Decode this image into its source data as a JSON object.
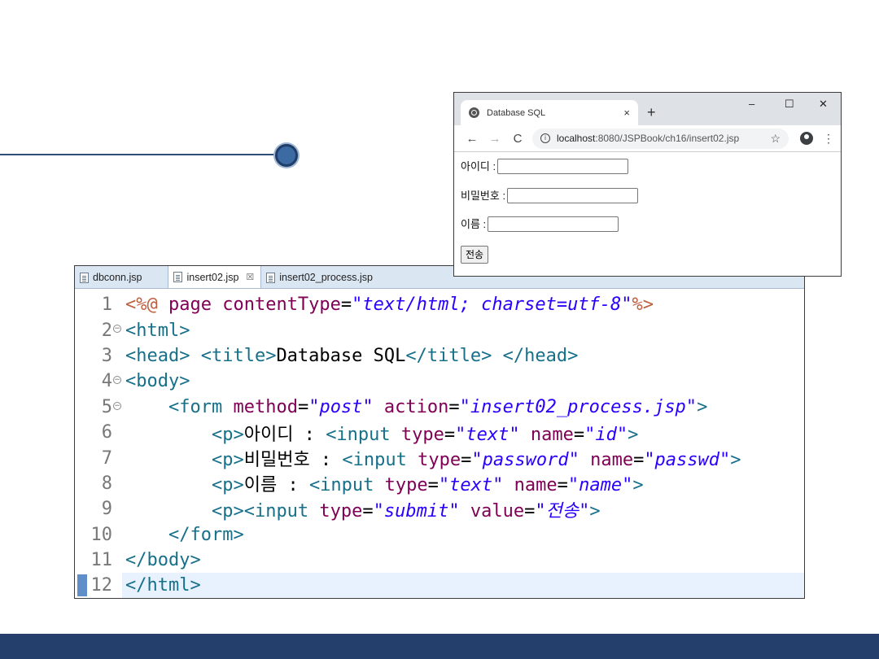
{
  "editor": {
    "tabs": [
      {
        "label": "dbconn.jsp",
        "active": false
      },
      {
        "label": "insert02.jsp",
        "active": true
      },
      {
        "label": "insert02_process.jsp",
        "active": false
      }
    ],
    "close_glyph": "☒",
    "lines": [
      {
        "num": "1",
        "fold": false,
        "tokens": [
          [
            "dir",
            "<%@ "
          ],
          [
            "attr",
            "page "
          ],
          [
            "attr",
            "contentType"
          ],
          [
            "text",
            "="
          ],
          [
            "val",
            "\"text/html; charset=utf-8\""
          ],
          [
            "dir",
            "%>"
          ]
        ]
      },
      {
        "num": "2",
        "fold": true,
        "tokens": [
          [
            "tag",
            "<html>"
          ]
        ]
      },
      {
        "num": "3",
        "fold": false,
        "tokens": [
          [
            "tag",
            "<head> "
          ],
          [
            "tag",
            "<title>"
          ],
          [
            "text",
            "Database SQL"
          ],
          [
            "tag",
            "</title> "
          ],
          [
            "tag",
            "</head>"
          ]
        ]
      },
      {
        "num": "4",
        "fold": true,
        "tokens": [
          [
            "tag",
            "<body>"
          ]
        ]
      },
      {
        "num": "5",
        "fold": true,
        "tokens": [
          [
            "text",
            "    "
          ],
          [
            "tag",
            "<form "
          ],
          [
            "attr",
            "method"
          ],
          [
            "text",
            "="
          ],
          [
            "val",
            "\"post\" "
          ],
          [
            "attr",
            "action"
          ],
          [
            "text",
            "="
          ],
          [
            "val",
            "\"insert02_process.jsp\""
          ],
          [
            "tag",
            ">"
          ]
        ]
      },
      {
        "num": "6",
        "fold": false,
        "tokens": [
          [
            "text",
            "        "
          ],
          [
            "tag",
            "<p>"
          ],
          [
            "text",
            "아이디 : "
          ],
          [
            "tag",
            "<input "
          ],
          [
            "attr",
            "type"
          ],
          [
            "text",
            "="
          ],
          [
            "val",
            "\"text\" "
          ],
          [
            "attr",
            "name"
          ],
          [
            "text",
            "="
          ],
          [
            "val",
            "\"id\""
          ],
          [
            "tag",
            ">"
          ]
        ]
      },
      {
        "num": "7",
        "fold": false,
        "tokens": [
          [
            "text",
            "        "
          ],
          [
            "tag",
            "<p>"
          ],
          [
            "text",
            "비밀번호 : "
          ],
          [
            "tag",
            "<input "
          ],
          [
            "attr",
            "type"
          ],
          [
            "text",
            "="
          ],
          [
            "val",
            "\"password\" "
          ],
          [
            "attr",
            "name"
          ],
          [
            "text",
            "="
          ],
          [
            "val",
            "\"passwd\""
          ],
          [
            "tag",
            ">"
          ]
        ]
      },
      {
        "num": "8",
        "fold": false,
        "tokens": [
          [
            "text",
            "        "
          ],
          [
            "tag",
            "<p>"
          ],
          [
            "text",
            "이름 : "
          ],
          [
            "tag",
            "<input "
          ],
          [
            "attr",
            "type"
          ],
          [
            "text",
            "="
          ],
          [
            "val",
            "\"text\" "
          ],
          [
            "attr",
            "name"
          ],
          [
            "text",
            "="
          ],
          [
            "val",
            "\"name\""
          ],
          [
            "tag",
            ">"
          ]
        ]
      },
      {
        "num": "9",
        "fold": false,
        "tokens": [
          [
            "text",
            "        "
          ],
          [
            "tag",
            "<p><input "
          ],
          [
            "attr",
            "type"
          ],
          [
            "text",
            "="
          ],
          [
            "val",
            "\"submit\" "
          ],
          [
            "attr",
            "value"
          ],
          [
            "text",
            "="
          ],
          [
            "val",
            "\"전송\""
          ],
          [
            "tag",
            ">"
          ]
        ]
      },
      {
        "num": "10",
        "fold": false,
        "tokens": [
          [
            "text",
            "    "
          ],
          [
            "tag",
            "</form>"
          ]
        ]
      },
      {
        "num": "11",
        "fold": false,
        "tokens": [
          [
            "tag",
            "</body>"
          ]
        ]
      },
      {
        "num": "12",
        "fold": false,
        "current": true,
        "tokens": [
          [
            "tag",
            "</html>"
          ]
        ]
      }
    ]
  },
  "browser": {
    "tab_title": "Database SQL",
    "tab_close": "×",
    "new_tab": "+",
    "minimize": "–",
    "maximize": "☐",
    "close": "✕",
    "back": "←",
    "forward": "→",
    "reload": "C",
    "url_host": "localhost",
    "url_path": ":8080/JSPBook/ch16/insert02.jsp",
    "star": "☆",
    "menu": "⋮",
    "form": {
      "id_label": "아이디 :",
      "passwd_label": "비밀번호 :",
      "name_label": "이름 :",
      "submit_label": "전송"
    }
  }
}
